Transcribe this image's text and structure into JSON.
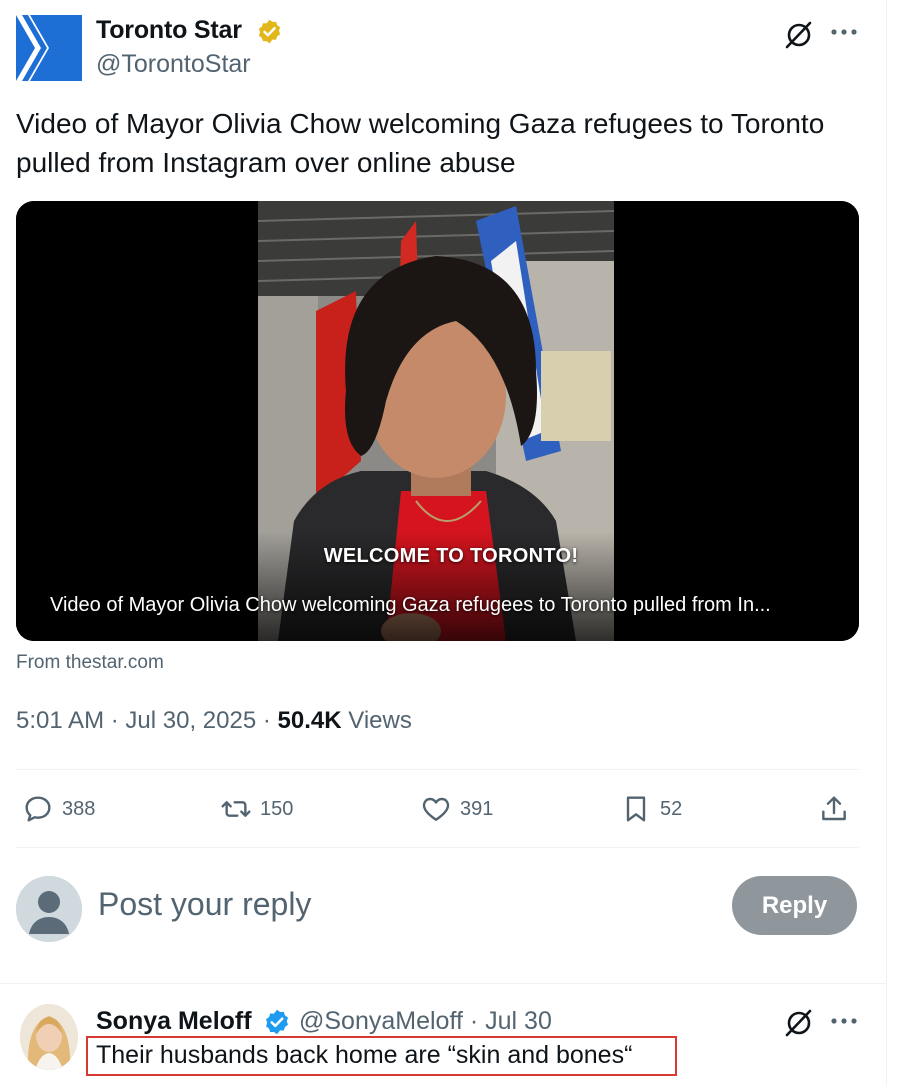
{
  "colors": {
    "brand_blue": "#1d6fd6",
    "verified_gold": "#e2b719",
    "verified_blue": "#1d9bf0",
    "secondary_text": "#536471",
    "reply_button_bg": "#8f979c",
    "highlight_box": "#d63a32"
  },
  "tweet": {
    "author": {
      "name": "Toronto Star",
      "handle": "@TorontoStar",
      "logo_icon": "toronto-star-logo",
      "badge_icon": "verified-gold-badge-icon"
    },
    "header_icons": [
      "grok-icon",
      "more-icon"
    ],
    "text": "Video of Mayor Olivia Chow welcoming Gaza refugees to Toronto pulled from Instagram over online abuse",
    "card": {
      "overlay_caption": "WELCOME TO TORONTO!",
      "title": "Video of Mayor Olivia Chow welcoming Gaza refugees to Toronto pulled from In...",
      "source": "From thestar.com"
    },
    "meta": {
      "time": "5:01 AM",
      "date": "Jul 30, 2025",
      "views_count": "50.4K",
      "views_label": "Views"
    },
    "actions": {
      "replies": "388",
      "reposts": "150",
      "likes": "391",
      "bookmarks": "52"
    }
  },
  "composer": {
    "placeholder": "Post your reply",
    "button_label": "Reply"
  },
  "reply": {
    "name": "Sonya Meloff",
    "handle": "@SonyaMeloff",
    "date": "Jul 30",
    "text": "Their husbands back home are “skin and bones“"
  }
}
